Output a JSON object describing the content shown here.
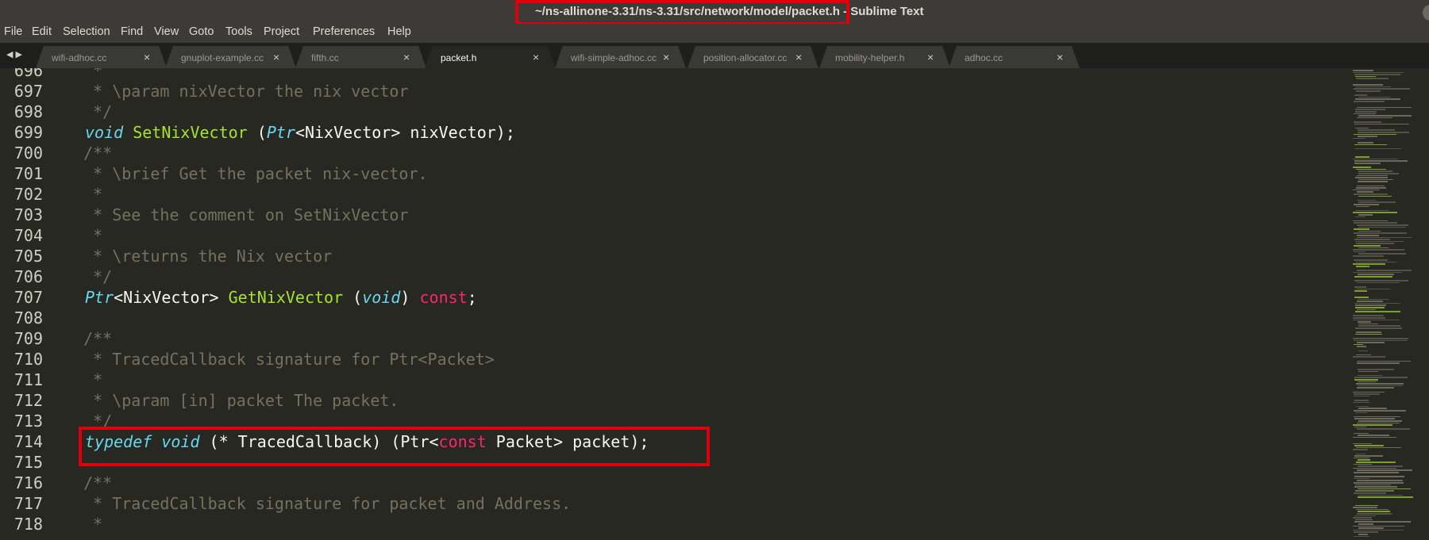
{
  "window": {
    "title_path": "~/ns-allinone-3.31/ns-3.31/src/network/model/packet.h",
    "title_suffix": " - Sublime Text"
  },
  "menu": [
    "File",
    "Edit",
    "Selection",
    "Find",
    "View",
    "Goto",
    "Tools",
    "Project",
    "Preferences",
    "Help"
  ],
  "tabs": [
    {
      "label": "wifi-adhoc.cc",
      "active": false
    },
    {
      "label": "gnuplot-example.cc",
      "active": false
    },
    {
      "label": "fifth.cc",
      "active": false
    },
    {
      "label": "packet.h",
      "active": true
    },
    {
      "label": "wifi-simple-adhoc.cc",
      "active": false
    },
    {
      "label": "position-allocator.cc",
      "active": false
    },
    {
      "label": "mobility-helper.h",
      "active": false
    },
    {
      "label": "adhoc.cc",
      "active": false
    }
  ],
  "tab_close_glyph": "×",
  "line_numbers": [
    "696",
    "697",
    "698",
    "699",
    "700",
    "701",
    "702",
    "703",
    "704",
    "705",
    "706",
    "707",
    "708",
    "709",
    "710",
    "711",
    "712",
    "713",
    "714",
    "715",
    "716",
    "717",
    "718"
  ],
  "code": {
    "l696": "   *",
    "l697": "   * \\param nixVector the nix vector",
    "l698": "   */",
    "l699": {
      "kw": "void",
      "fn": "SetNixVector",
      "a": " (",
      "kw2": "Ptr",
      "b": "<NixVector> nixVector);"
    },
    "l700": "  /**",
    "l701": "   * \\brief Get the packet nix-vector.",
    "l702": "   *",
    "l703": "   * See the comment on SetNixVector",
    "l704": "   *",
    "l705": "   * \\returns the Nix vector",
    "l706": "   */",
    "l707": {
      "kw": "Ptr",
      "a": "<NixVector> ",
      "fn": "GetNixVector",
      "b": " (",
      "kw2": "void",
      "c": ") ",
      "red": "const",
      "d": ";"
    },
    "l708": "",
    "l709": "  /**",
    "l710": "   * TracedCallback signature for Ptr<Packet>",
    "l711": "   *",
    "l712": "   * \\param [in] packet The packet.",
    "l713": "   */",
    "l714": {
      "kw": "typedef",
      "kw2": "void",
      "a": " (* TracedCallback) (Ptr<",
      "red": "const",
      "b": " Packet> packet);"
    },
    "l715": "",
    "l716": "  /**",
    "l717": "   * TracedCallback signature for packet and Address.",
    "l718": "   *"
  }
}
